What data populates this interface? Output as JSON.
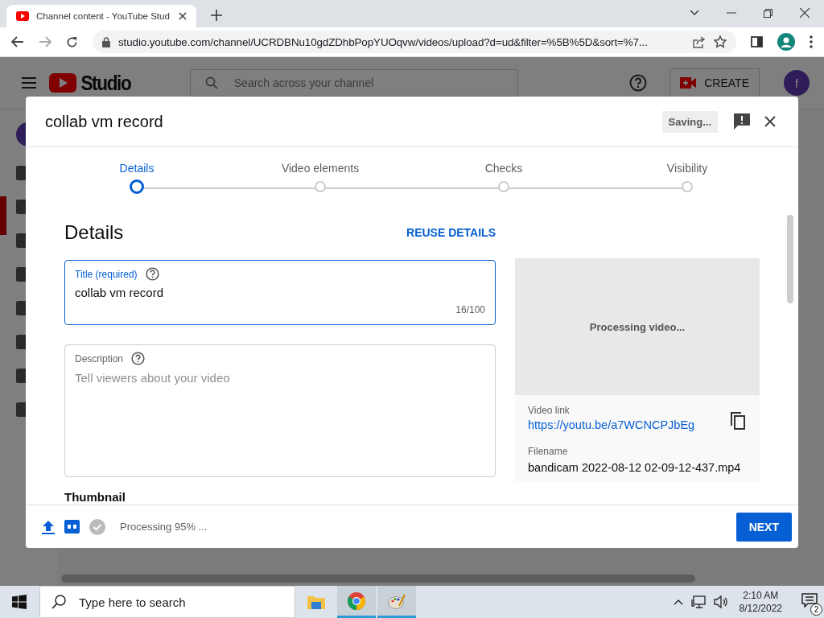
{
  "browser": {
    "tab_title": "Channel content - YouTube Stud",
    "url": "studio.youtube.com/channel/UCRDBNu10gdZDhbPopYUOqvw/videos/upload?d=ud&filter=%5B%5D&sort=%7..."
  },
  "studio": {
    "logo_text": "Studio",
    "search_placeholder": "Search across your channel",
    "create_label": "CREATE",
    "avatar_letter": "f"
  },
  "dialog": {
    "title": "collab vm record",
    "status": "Saving...",
    "steps": [
      {
        "label": "Details",
        "selected": true
      },
      {
        "label": "Video elements",
        "selected": false
      },
      {
        "label": "Checks",
        "selected": false
      },
      {
        "label": "Visibility",
        "selected": false
      }
    ],
    "section_title": "Details",
    "reuse": "REUSE DETAILS",
    "title_field": {
      "label": "Title (required)",
      "value": "collab vm record",
      "counter": "16/100"
    },
    "description_field": {
      "label": "Description",
      "placeholder": "Tell viewers about your video"
    },
    "preview": {
      "status": "Processing video...",
      "link_label": "Video link",
      "link": "https://youtu.be/a7WCNCPJbEg",
      "filename_label": "Filename",
      "filename": "bandicam 2022-08-12 02-09-12-437.mp4"
    },
    "thumbnail_heading": "Thumbnail",
    "footer": {
      "progress": "Processing 95% ...",
      "next": "NEXT"
    }
  },
  "taskbar": {
    "search_placeholder": "Type here to search",
    "time": "2:10 AM",
    "date": "8/12/2022",
    "notifications": "2"
  }
}
